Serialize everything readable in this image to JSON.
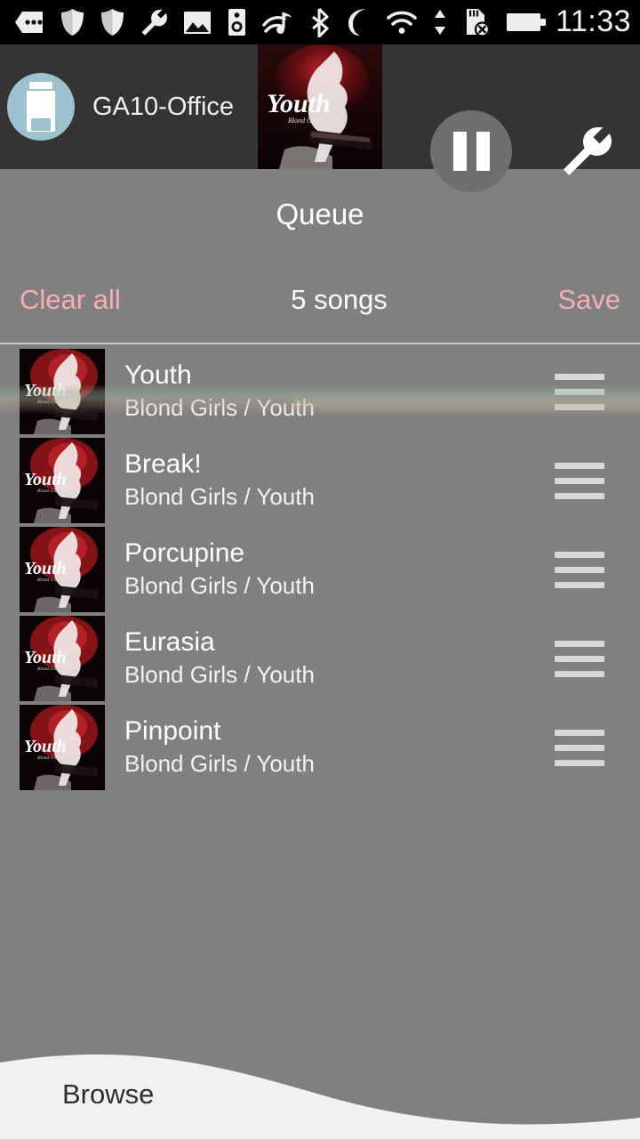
{
  "statusbar": {
    "time": "11:33",
    "icons": [
      {
        "name": "message-dots-icon"
      },
      {
        "name": "shield-icon"
      },
      {
        "name": "shield-icon"
      },
      {
        "name": "wrench-icon"
      },
      {
        "name": "image-icon"
      },
      {
        "name": "speaker-icon"
      },
      {
        "name": "music-cast-icon"
      },
      {
        "name": "bluetooth-icon"
      },
      {
        "name": "moon-do-not-disturb-icon"
      },
      {
        "name": "wifi-icon"
      },
      {
        "name": "data-transfer-icon"
      },
      {
        "name": "sd-card-removed-icon"
      },
      {
        "name": "battery-icon"
      }
    ]
  },
  "topbar": {
    "device_name": "GA10-Office",
    "device_icon": "speaker-icon",
    "album_art_alt": "Youth",
    "pause_icon": "pause-icon",
    "settings_icon": "wrench-icon"
  },
  "queue": {
    "title": "Queue",
    "clear_all_label": "Clear all",
    "count_label": "5 songs",
    "save_label": "Save",
    "accent_color": "#f7adb6",
    "songs": [
      {
        "title": "Youth",
        "subtitle": "Blond Girls / Youth",
        "art_alt": "Youth",
        "handle_icon": "drag-handle-icon"
      },
      {
        "title": "Break!",
        "subtitle": "Blond Girls / Youth",
        "art_alt": "Youth",
        "handle_icon": "drag-handle-icon"
      },
      {
        "title": "Porcupine",
        "subtitle": "Blond Girls / Youth",
        "art_alt": "Youth",
        "handle_icon": "drag-handle-icon"
      },
      {
        "title": "Eurasia",
        "subtitle": "Blond Girls / Youth",
        "art_alt": "Youth",
        "handle_icon": "drag-handle-icon"
      },
      {
        "title": "Pinpoint",
        "subtitle": "Blond Girls / Youth",
        "art_alt": "Youth",
        "handle_icon": "drag-handle-icon"
      }
    ]
  },
  "bottom": {
    "browse_label": "Browse"
  },
  "colors": {
    "background": "#808080",
    "topbar": "#343434",
    "statusbar": "#000000",
    "accent_pink": "#f7adb6",
    "avatar_circle": "#9dc2ce",
    "sheet": "#f1f1f1"
  }
}
